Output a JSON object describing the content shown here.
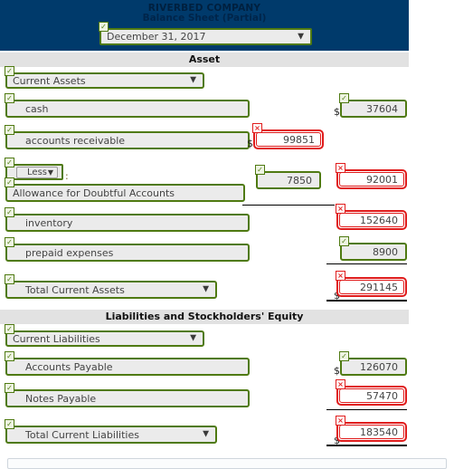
{
  "header": {
    "company": "RIVERBED COMPANY",
    "report": "Balance Sheet (Partial)",
    "period_value": "December 31, 2017",
    "period_status": "valid",
    "background_color": "#003a6b"
  },
  "icons": {
    "check": "✓",
    "cross": "×",
    "caret_down": "▼",
    "dollar": "$"
  },
  "sections": [
    {
      "band_label": "Asset",
      "rows": [
        {
          "type": "select",
          "label": "Current Assets",
          "label_status": "valid",
          "amount_col1": null,
          "amount_col2": null
        },
        {
          "type": "item",
          "label": "cash",
          "label_status": "valid",
          "amount_col1": null,
          "amount_col2": {
            "value": "37604",
            "status": "valid",
            "dollar": true
          }
        },
        {
          "type": "item",
          "label": "accounts receivable",
          "label_status": "valid",
          "amount_col1": {
            "value": "99851",
            "status": "invalid",
            "dollar": true
          },
          "amount_col2": null
        },
        {
          "type": "less",
          "less_label": "Less",
          "colon": ":",
          "label_status": "valid"
        },
        {
          "type": "item",
          "label": "Allowance for Doubtful Accounts",
          "label_status": "valid",
          "indent": false,
          "amount_col1": {
            "value": "7850",
            "status": "valid",
            "dollar": false,
            "underline": "thin"
          },
          "amount_col2": {
            "value": "92001",
            "status": "invalid",
            "dollar": false
          }
        },
        {
          "type": "item",
          "label": "inventory",
          "label_status": "valid",
          "amount_col1": null,
          "amount_col2": {
            "value": "152640",
            "status": "invalid",
            "dollar": false
          }
        },
        {
          "type": "item",
          "label": "prepaid expenses",
          "label_status": "valid",
          "amount_col1": null,
          "amount_col2": {
            "value": "8900",
            "status": "valid",
            "dollar": false,
            "underline": "thin"
          }
        },
        {
          "type": "total",
          "label": "Total Current Assets",
          "label_status": "valid",
          "amount_col1": null,
          "amount_col2": {
            "value": "291145",
            "status": "invalid",
            "dollar": true,
            "underline": "thick"
          }
        }
      ]
    },
    {
      "band_label": "Liabilities and Stockholders' Equity",
      "rows": [
        {
          "type": "select",
          "label": "Current Liabilities",
          "label_status": "valid",
          "amount_col1": null,
          "amount_col2": null
        },
        {
          "type": "item",
          "label": "Accounts Payable",
          "label_status": "valid",
          "amount_col1": null,
          "amount_col2": {
            "value": "126070",
            "status": "valid",
            "dollar": true
          }
        },
        {
          "type": "item",
          "label": "Notes Payable",
          "label_status": "valid",
          "amount_col1": null,
          "amount_col2": {
            "value": "57470",
            "status": "invalid",
            "dollar": false,
            "underline": "thin"
          }
        },
        {
          "type": "total",
          "label": "Total Current Liabilities",
          "label_status": "valid",
          "amount_col1": null,
          "amount_col2": {
            "value": "183540",
            "status": "invalid",
            "dollar": true,
            "underline": "thick"
          }
        }
      ]
    }
  ]
}
